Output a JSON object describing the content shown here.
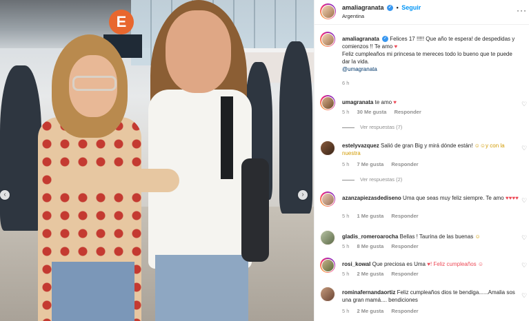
{
  "photo": {
    "sign_letter": "E",
    "nav_left": "‹",
    "nav_right": "›"
  },
  "header": {
    "username": "amaliagranata",
    "verified_glyph": "✓",
    "separator": "•",
    "follow_label": "Seguir",
    "location": "Argentina",
    "more_glyph": "···"
  },
  "caption": {
    "username": "amaliagranata",
    "line1": "Felices 17 !!!!! Que año te espera! de despedidas y comienzos !! Te amo",
    "heart": "♥",
    "line2": "Feliz cumpleaños mi princesa te mereces todo lo bueno que te puede dar la vida.",
    "mention": "@umagranata",
    "time": "6 h"
  },
  "comments": [
    {
      "username": "umagranata",
      "text": "te amo",
      "suffix": "♥",
      "time": "5 h",
      "likes": "30 Me gusta",
      "reply": "Responder",
      "replies": "Ver respuestas (7)",
      "like_icon": "♡"
    },
    {
      "username": "estelyvazquez",
      "text": "Salió de gran Big y mirá dónde están!",
      "suffix": "☺☺y con la nuestra",
      "time": "5 h",
      "likes": "7 Me gusta",
      "reply": "Responder",
      "replies": "Ver respuestas (2)",
      "like_icon": "♡"
    },
    {
      "username": "azanzapiezasdediseno",
      "text": "Uma que seas muy feliz siempre. Te amo",
      "suffix": "♥♥♥♥",
      "time": "5 h",
      "likes": "1 Me gusta",
      "reply": "Responder",
      "replies": "",
      "like_icon": "♡"
    },
    {
      "username": "gladis_romeroarocha",
      "text": "Bellas ! Taurina de las buenas",
      "suffix": "☺",
      "time": "5 h",
      "likes": "8 Me gusta",
      "reply": "Responder",
      "replies": "",
      "like_icon": "♡"
    },
    {
      "username": "rosi_kowal",
      "text": "Que preciosa es Uma",
      "suffix": "♥! Feliz cumpleaños ☺",
      "time": "5 h",
      "likes": "2 Me gusta",
      "reply": "Responder",
      "replies": "",
      "like_icon": "♡"
    },
    {
      "username": "rominafernandaortiz",
      "text": "Feliz cumpleaños dios te bendiga......Amalia sos una gran mamá.... bendiciones",
      "suffix": "",
      "time": "5 h",
      "likes": "2 Me gusta",
      "reply": "Responder",
      "replies": "",
      "like_icon": "♡"
    }
  ]
}
